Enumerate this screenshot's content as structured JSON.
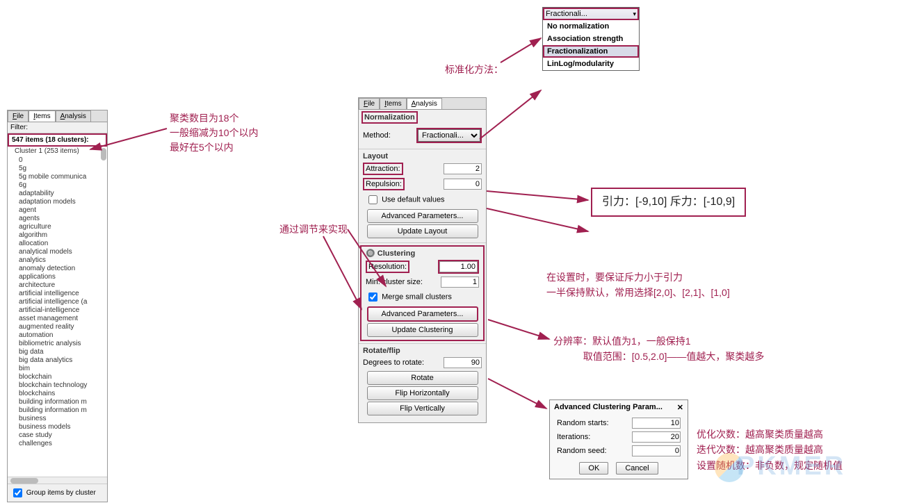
{
  "left_panel": {
    "tabs": [
      "File",
      "Items",
      "Analysis"
    ],
    "filter_label": "Filter:",
    "summary": "547 items (18 clusters):",
    "cluster1_header": "Cluster 1 (253 items)",
    "items": [
      "0",
      "5g",
      "5g mobile communica",
      "6g",
      "adaptability",
      "adaptation models",
      "agent",
      "agents",
      "agriculture",
      "algorithm",
      "allocation",
      "analytical models",
      "analytics",
      "anomaly detection",
      "applications",
      "architecture",
      "artificial intelligence",
      "artificial intelligence (a",
      "artificial-intelligence",
      "asset management",
      "augmented reality",
      "automation",
      "bibliometric analysis",
      "big data",
      "big data analytics",
      "bim",
      "blockchain",
      "blockchain technology",
      "blockchains",
      "building information m",
      "building information m",
      "business",
      "business models",
      "case study",
      "challenges"
    ],
    "group_label": "Group items by cluster"
  },
  "center_panel": {
    "tabs": [
      "File",
      "Items",
      "Analysis"
    ],
    "norm_title": "Normalization",
    "method_label": "Method:",
    "method_value": "Fractionali...",
    "layout_title": "Layout",
    "attraction_label": "Attraction:",
    "attraction_value": "2",
    "repulsion_label": "Repulsion:",
    "repulsion_value": "0",
    "use_default": "Use default values",
    "adv_params_btn": "Advanced Parameters...",
    "update_layout_btn": "Update Layout",
    "clustering_title": "Clustering",
    "resolution_label": "Resolution:",
    "resolution_value": "1.00",
    "min_cluster_label": "Min. cluster size:",
    "min_cluster_value": "1",
    "merge_label": "Merge small clusters",
    "update_clustering_btn": "Update Clustering",
    "rotate_title": "Rotate/flip",
    "degrees_label": "Degrees to rotate:",
    "degrees_value": "90",
    "rotate_btn": "Rotate",
    "flip_h_btn": "Flip Horizontally",
    "flip_v_btn": "Flip Vertically"
  },
  "norm_popup": {
    "selected_display": "Fractionali...",
    "options": [
      "No normalization",
      "Association strength",
      "Fractionalization",
      "LinLog/modularity"
    ]
  },
  "annotations": {
    "norm_method": "标准化方法：",
    "cluster_count": "聚类数目为18个\n一般缩减为10个以内\n最好在5个以内",
    "adjust": "通过调节来实现",
    "attract_repulse_box": "引力：[-9,10]\n\n斥力：[-10,9]",
    "attract_repulse_notes": "在设置时，要保证斥力小于引力\n一半保持默认，常用选择[2,0]、[2,1]、[1,0]",
    "resolution_notes": "分辨率：默认值为1，一般保持1\n           取值范围：[0.5,2.0]——值越大，聚类越多",
    "adv_notes": "优化次数：越高聚类质量越高\n迭代次数：越高聚类质量越高\n设置随机数：非负数，规定随机值"
  },
  "adv_dialog": {
    "title": "Advanced Clustering Param...",
    "random_starts_label": "Random starts:",
    "random_starts_value": "10",
    "iterations_label": "Iterations:",
    "iterations_value": "20",
    "random_seed_label": "Random seed:",
    "random_seed_value": "0",
    "ok": "OK",
    "cancel": "Cancel"
  },
  "watermark": "PKMER"
}
